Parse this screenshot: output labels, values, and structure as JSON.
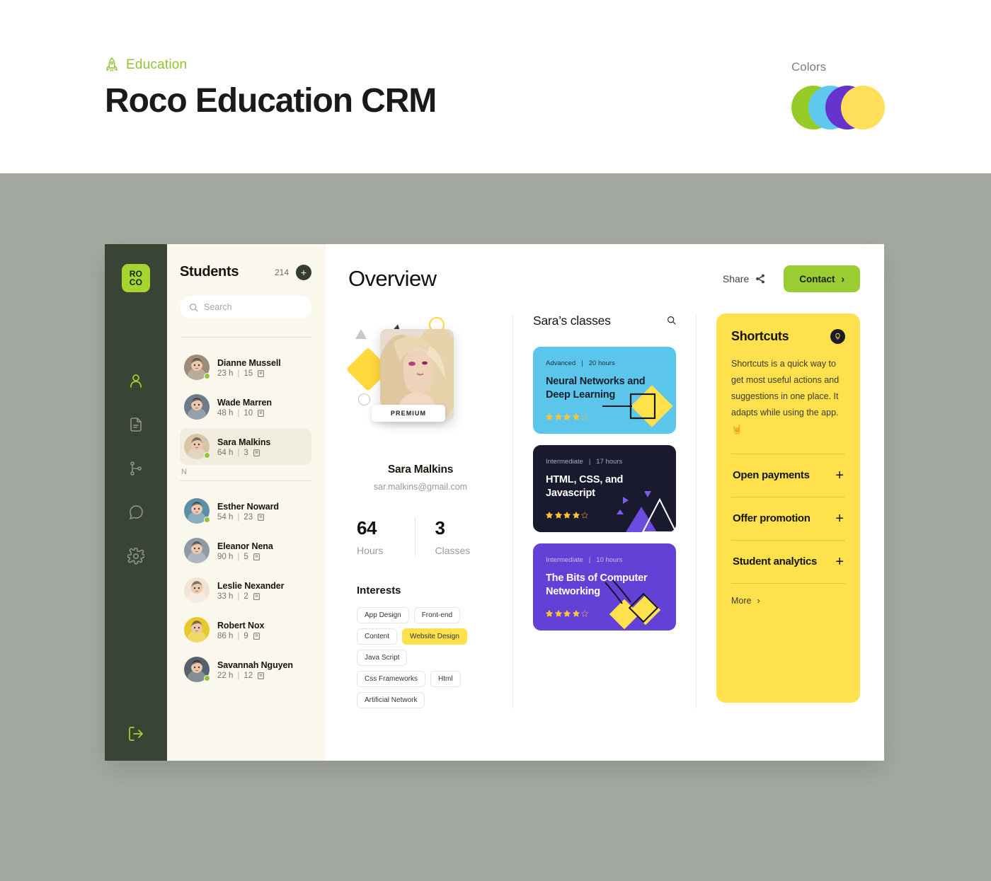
{
  "banner": {
    "kicker": "Education",
    "kicker_icon": "rocket-icon",
    "title": "Roco Education CRM",
    "colors_label": "Colors",
    "swatches": [
      "#96CC28",
      "#5EC8EE",
      "#6633CC",
      "#FFDE59"
    ]
  },
  "rail": {
    "logo_top": "RO",
    "logo_bottom": "CO",
    "nav": [
      {
        "name": "users-icon",
        "active": true
      },
      {
        "name": "document-icon",
        "active": false
      },
      {
        "name": "branch-icon",
        "active": false
      },
      {
        "name": "chat-icon",
        "active": false
      },
      {
        "name": "gear-icon",
        "active": false
      }
    ],
    "logout_icon": "logout-icon"
  },
  "students": {
    "title": "Students",
    "count": "214",
    "add_label": "+",
    "search_placeholder": "Search",
    "search_value": "",
    "group_letter": "N",
    "list": [
      {
        "name": "Dianne Mussell",
        "hours": "23 h",
        "classes": "15",
        "online": true,
        "selected": false,
        "photo": "#9E8C78"
      },
      {
        "name": "Wade Marren",
        "hours": "48 h",
        "classes": "10",
        "online": false,
        "selected": false,
        "photo": "#6E7C8A"
      },
      {
        "name": "Sara Malkins",
        "hours": "64 h",
        "classes": "3",
        "online": true,
        "selected": true,
        "photo": "#D9C5A8"
      }
    ],
    "list_group": [
      {
        "name": "Esther Noward",
        "hours": "54 h",
        "classes": "23",
        "online": true,
        "selected": false,
        "photo": "#5E8FA8"
      },
      {
        "name": "Eleanor Nena",
        "hours": "90 h",
        "classes": "5",
        "online": false,
        "selected": false,
        "photo": "#8E9BA6"
      },
      {
        "name": "Leslie Nexander",
        "hours": "33 h",
        "classes": "2",
        "online": false,
        "selected": false,
        "photo": "#F2E4D4"
      },
      {
        "name": "Robert Nox",
        "hours": "86 h",
        "classes": "9",
        "online": false,
        "selected": false,
        "photo": "#E8C92B"
      },
      {
        "name": "Savannah Nguyen",
        "hours": "22 h",
        "classes": "12",
        "online": true,
        "selected": false,
        "photo": "#57616B"
      }
    ]
  },
  "main": {
    "title": "Overview",
    "share_label": "Share",
    "contact_label": "Contact"
  },
  "profile": {
    "badge": "PREMIUM",
    "name": "Sara Malkins",
    "email": "sar.malkins@gmail.com",
    "stats": [
      {
        "value": "64",
        "label": "Hours"
      },
      {
        "value": "3",
        "label": "Classes"
      }
    ],
    "interests_title": "Interests",
    "interests": [
      {
        "label": "App Design",
        "active": false
      },
      {
        "label": "Front-end",
        "active": false
      },
      {
        "label": "Content",
        "active": false
      },
      {
        "label": "Website Design",
        "active": true
      },
      {
        "label": "Java Script",
        "active": false
      },
      {
        "label": "Css Frameworks",
        "active": false
      },
      {
        "label": "Html",
        "active": false
      },
      {
        "label": "Artificial Network",
        "active": false
      }
    ]
  },
  "classes": {
    "title": "Sara’s classes",
    "search_icon": "search-icon",
    "cards": [
      {
        "level": "Advanced",
        "hours": "20 hours",
        "title": "Neural Networks and Deep Learning",
        "rating": 4.5,
        "bg": "#5BC5EC",
        "fg": "#16202B",
        "meta_fg": "#1C3340",
        "deco": "square-diamond"
      },
      {
        "level": "Intermediate",
        "hours": "17 hours",
        "title": "HTML, CSS, and Javascript",
        "rating": 4.5,
        "bg": "#191A2E",
        "fg": "#FFFFFF",
        "meta_fg": "#A9AABC",
        "deco": "mountains"
      },
      {
        "level": "Intermediate",
        "hours": "10 hours",
        "title": "The Bits of Computer Networking",
        "rating": 4.5,
        "bg": "#6341D6",
        "fg": "#FFFFFF",
        "meta_fg": "#C9BDF2",
        "deco": "diamonds"
      }
    ]
  },
  "shortcuts": {
    "title": "Shortcuts",
    "icon": "lightbulb-icon",
    "description": "Shortcuts is a quick way to get most useful actions and suggestions in one place. It adapts while using the app. 🤘",
    "items": [
      {
        "label": "Open payments",
        "action": "+"
      },
      {
        "label": "Offer promotion",
        "action": "+"
      },
      {
        "label": "Student analytics",
        "action": "+"
      }
    ],
    "more_label": "More"
  }
}
